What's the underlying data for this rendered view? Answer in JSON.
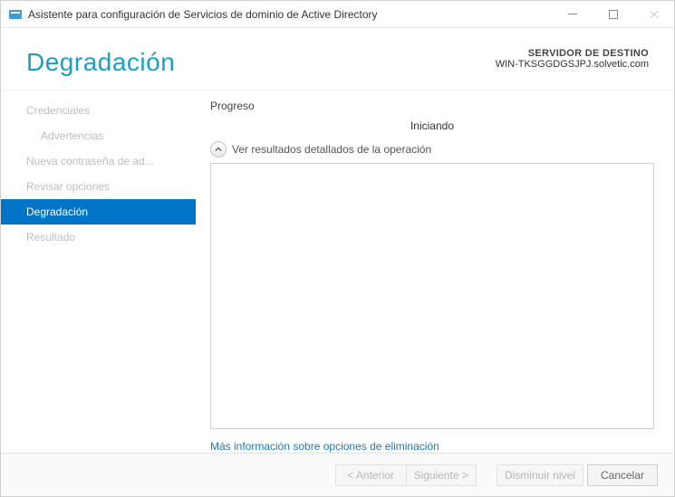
{
  "window": {
    "title": "Asistente para configuración de Servicios de dominio de Active Directory"
  },
  "header": {
    "wizard_title": "Degradación",
    "target_label": "SERVIDOR DE DESTINO",
    "target_value": "WIN-TKSGGDGSJPJ.solvetic.com"
  },
  "steps": {
    "0": {
      "label": "Credenciales"
    },
    "1": {
      "label": "Advertencias"
    },
    "2": {
      "label": "Nueva contraseña de ad..."
    },
    "3": {
      "label": "Revisar opciones"
    },
    "4": {
      "label": "Degradación"
    },
    "5": {
      "label": "Resultado"
    }
  },
  "main": {
    "section_label": "Progreso",
    "status": "Iniciando",
    "expander_label": "Ver resultados detallados de la operación",
    "info_link": "Más información sobre opciones de eliminación"
  },
  "footer": {
    "prev": "< Anterior",
    "next": "Siguiente >",
    "demote": "Disminuir nivel",
    "cancel": "Cancelar"
  }
}
